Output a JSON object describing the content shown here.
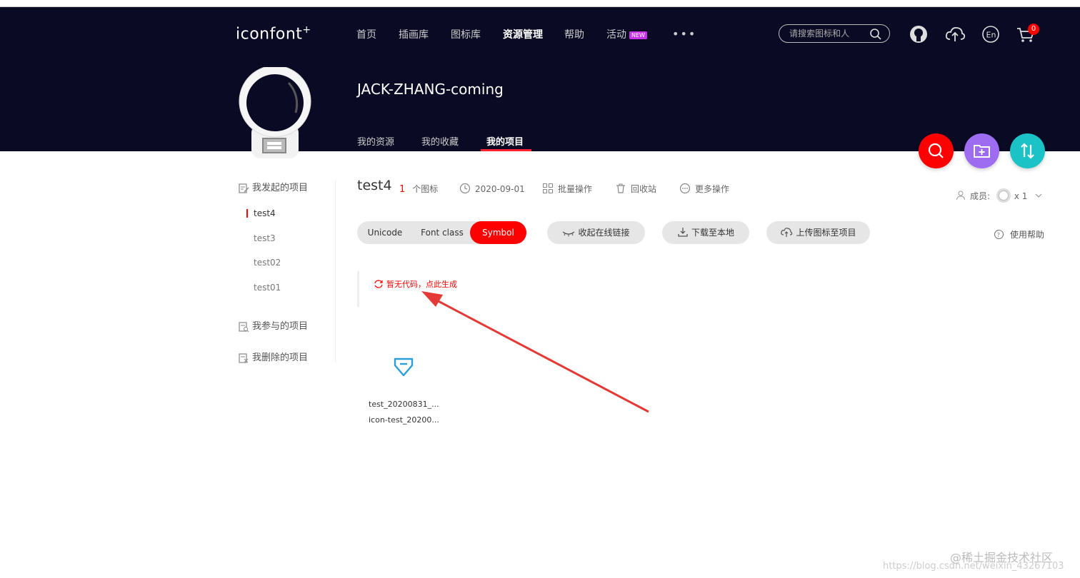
{
  "header": {
    "logo_text": "iconfont",
    "logo_plus": "+",
    "nav": {
      "home": "首页",
      "illustrations": "插画库",
      "icons": "图标库",
      "resources": "资源管理",
      "help": "帮助",
      "activity": "活动",
      "activity_badge": "NEW",
      "more": "•••"
    },
    "search_placeholder": "请搜索图标和人",
    "cart_count": "0"
  },
  "profile": {
    "username": "JACK-ZHANG-coming",
    "tabs": {
      "resources": "我的资源",
      "favorites": "我的收藏",
      "projects": "我的项目"
    }
  },
  "sidebar": {
    "initiated": "我发起的项目",
    "projects": [
      "test4",
      "test3",
      "test02",
      "test01"
    ],
    "joined": "我参与的项目",
    "deleted": "我删除的项目"
  },
  "project": {
    "title": "test4",
    "icon_count": "1",
    "icon_count_label": "个图标",
    "date": "2020-09-01",
    "batch": "批量操作",
    "recycle": "回收站",
    "more_ops": "更多操作",
    "members_label": "成员:",
    "members_count": "x 1"
  },
  "toolbar": {
    "unicode": "Unicode",
    "font_class": "Font class",
    "symbol": "Symbol",
    "collapse_link": "收起在线链接",
    "download": "下载至本地",
    "upload": "上传图标至项目",
    "help": "使用帮助"
  },
  "code_area": {
    "generate_link": "暂无代码，点此生成"
  },
  "icons": [
    {
      "name": "test_20200831_...",
      "code": "icon-test_20200..."
    }
  ],
  "watermark": {
    "line1": "@稀土掘金技术社区",
    "line2": "https://blog.csdn.net/weixin_43267103"
  },
  "colors": {
    "header_bg": "#0a0a24",
    "accent_red": "#ff0000",
    "fab_purple": "#9d6cf0",
    "fab_teal": "#1cc3c6",
    "icon_blue": "#2a9fd8"
  }
}
